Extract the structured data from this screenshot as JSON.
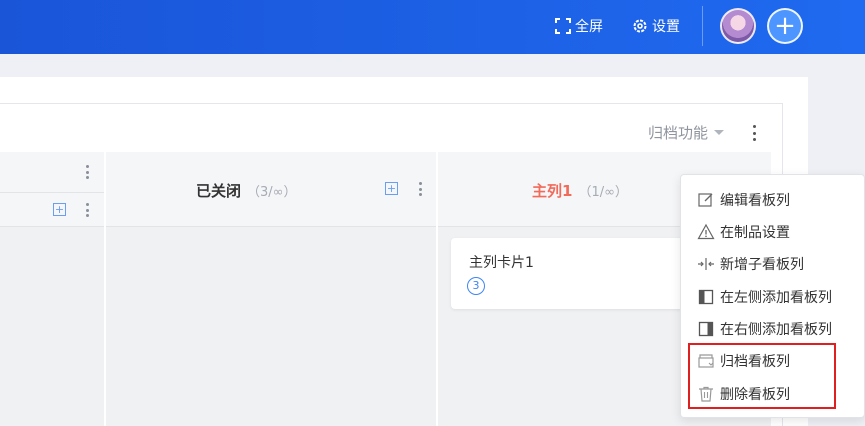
{
  "topbar": {
    "fullscreen_label": "全屏",
    "settings_label": "设置",
    "add_icon": "plus-icon",
    "color": "#1f6af0"
  },
  "toolbar": {
    "archive_function_label": "归档功能"
  },
  "columns": [
    {
      "title": "已关闭",
      "count": "（3/∞）"
    },
    {
      "title": "主列1",
      "count": "（1/∞）",
      "title_color": "#f26a5a"
    }
  ],
  "card": {
    "title": "主列卡片1",
    "badge": "3"
  },
  "menu": {
    "items": [
      {
        "label": "编辑看板列",
        "icon": "edit-icon"
      },
      {
        "label": "在制品设置",
        "icon": "warning-icon"
      },
      {
        "label": "新增子看板列",
        "icon": "split-arrows-icon"
      },
      {
        "label": "在左侧添加看板列",
        "icon": "column-left-icon"
      },
      {
        "label": "在右侧添加看板列",
        "icon": "column-right-icon"
      },
      {
        "label": "归档看板列",
        "icon": "archive-icon"
      },
      {
        "label": "删除看板列",
        "icon": "trash-icon"
      }
    ],
    "highlight_color": "#e02020"
  }
}
